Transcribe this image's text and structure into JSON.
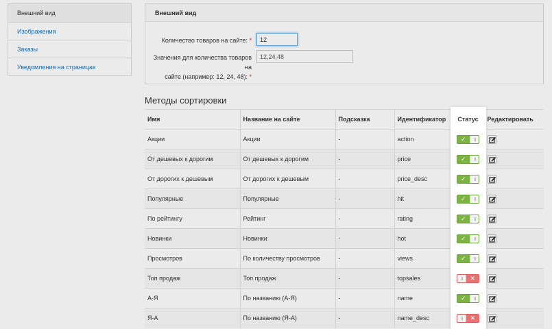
{
  "sidebar": {
    "items": [
      {
        "label": "Внешний вид",
        "active": true
      },
      {
        "label": "Изображения",
        "active": false
      },
      {
        "label": "Заказы",
        "active": false
      },
      {
        "label": "Уведомления на страницах",
        "active": false
      }
    ]
  },
  "panel": {
    "title": "Внешний вид",
    "products_label": "Количество товаров на сайте:",
    "products_value": "12",
    "values_label_line1": "Значения для количества товаров на",
    "values_label_line2": "сайте (например: 12, 24, 48):",
    "values_value": "12,24,48",
    "required_mark": "*"
  },
  "sorting": {
    "title": "Методы сортировки",
    "columns": [
      "Имя",
      "Название на сайте",
      "Подсказка",
      "Идентификатор",
      "Статус",
      "Редактировать"
    ],
    "rows": [
      {
        "name": "Акции",
        "site_name": "Акции",
        "hint": "-",
        "id": "action",
        "status": "on"
      },
      {
        "name": "От дешевых к дорогим",
        "site_name": "От дешевых к дорогим",
        "hint": "-",
        "id": "price",
        "status": "on"
      },
      {
        "name": "От дорогих к дешевым",
        "site_name": "От дорогих к дешевым",
        "hint": "-",
        "id": "price_desc",
        "status": "on"
      },
      {
        "name": "Популярные",
        "site_name": "Популярные",
        "hint": "-",
        "id": "hit",
        "status": "on"
      },
      {
        "name": "По рейтингу",
        "site_name": "Рейтинг",
        "hint": "-",
        "id": "rating",
        "status": "on"
      },
      {
        "name": "Новинки",
        "site_name": "Новинки",
        "hint": "-",
        "id": "hot",
        "status": "on"
      },
      {
        "name": "Просмотров",
        "site_name": "По количеству просмотров",
        "hint": "-",
        "id": "views",
        "status": "on"
      },
      {
        "name": "Топ продаж",
        "site_name": "Топ продаж",
        "hint": "-",
        "id": "topsales",
        "status": "off"
      },
      {
        "name": "А-Я",
        "site_name": "По названию (А-Я)",
        "hint": "-",
        "id": "name",
        "status": "on"
      },
      {
        "name": "Я-А",
        "site_name": "По названию (Я-А)",
        "hint": "-",
        "id": "name_desc",
        "status": "off"
      }
    ]
  },
  "colors": {
    "toggle_on": "#7cb342",
    "toggle_off": "#e57373",
    "link": "#1f6fb2",
    "required": "#c9302c"
  },
  "icons": {
    "toggle_on_mark": "✓",
    "toggle_off_mark": "✕",
    "edit": "edit-icon"
  }
}
